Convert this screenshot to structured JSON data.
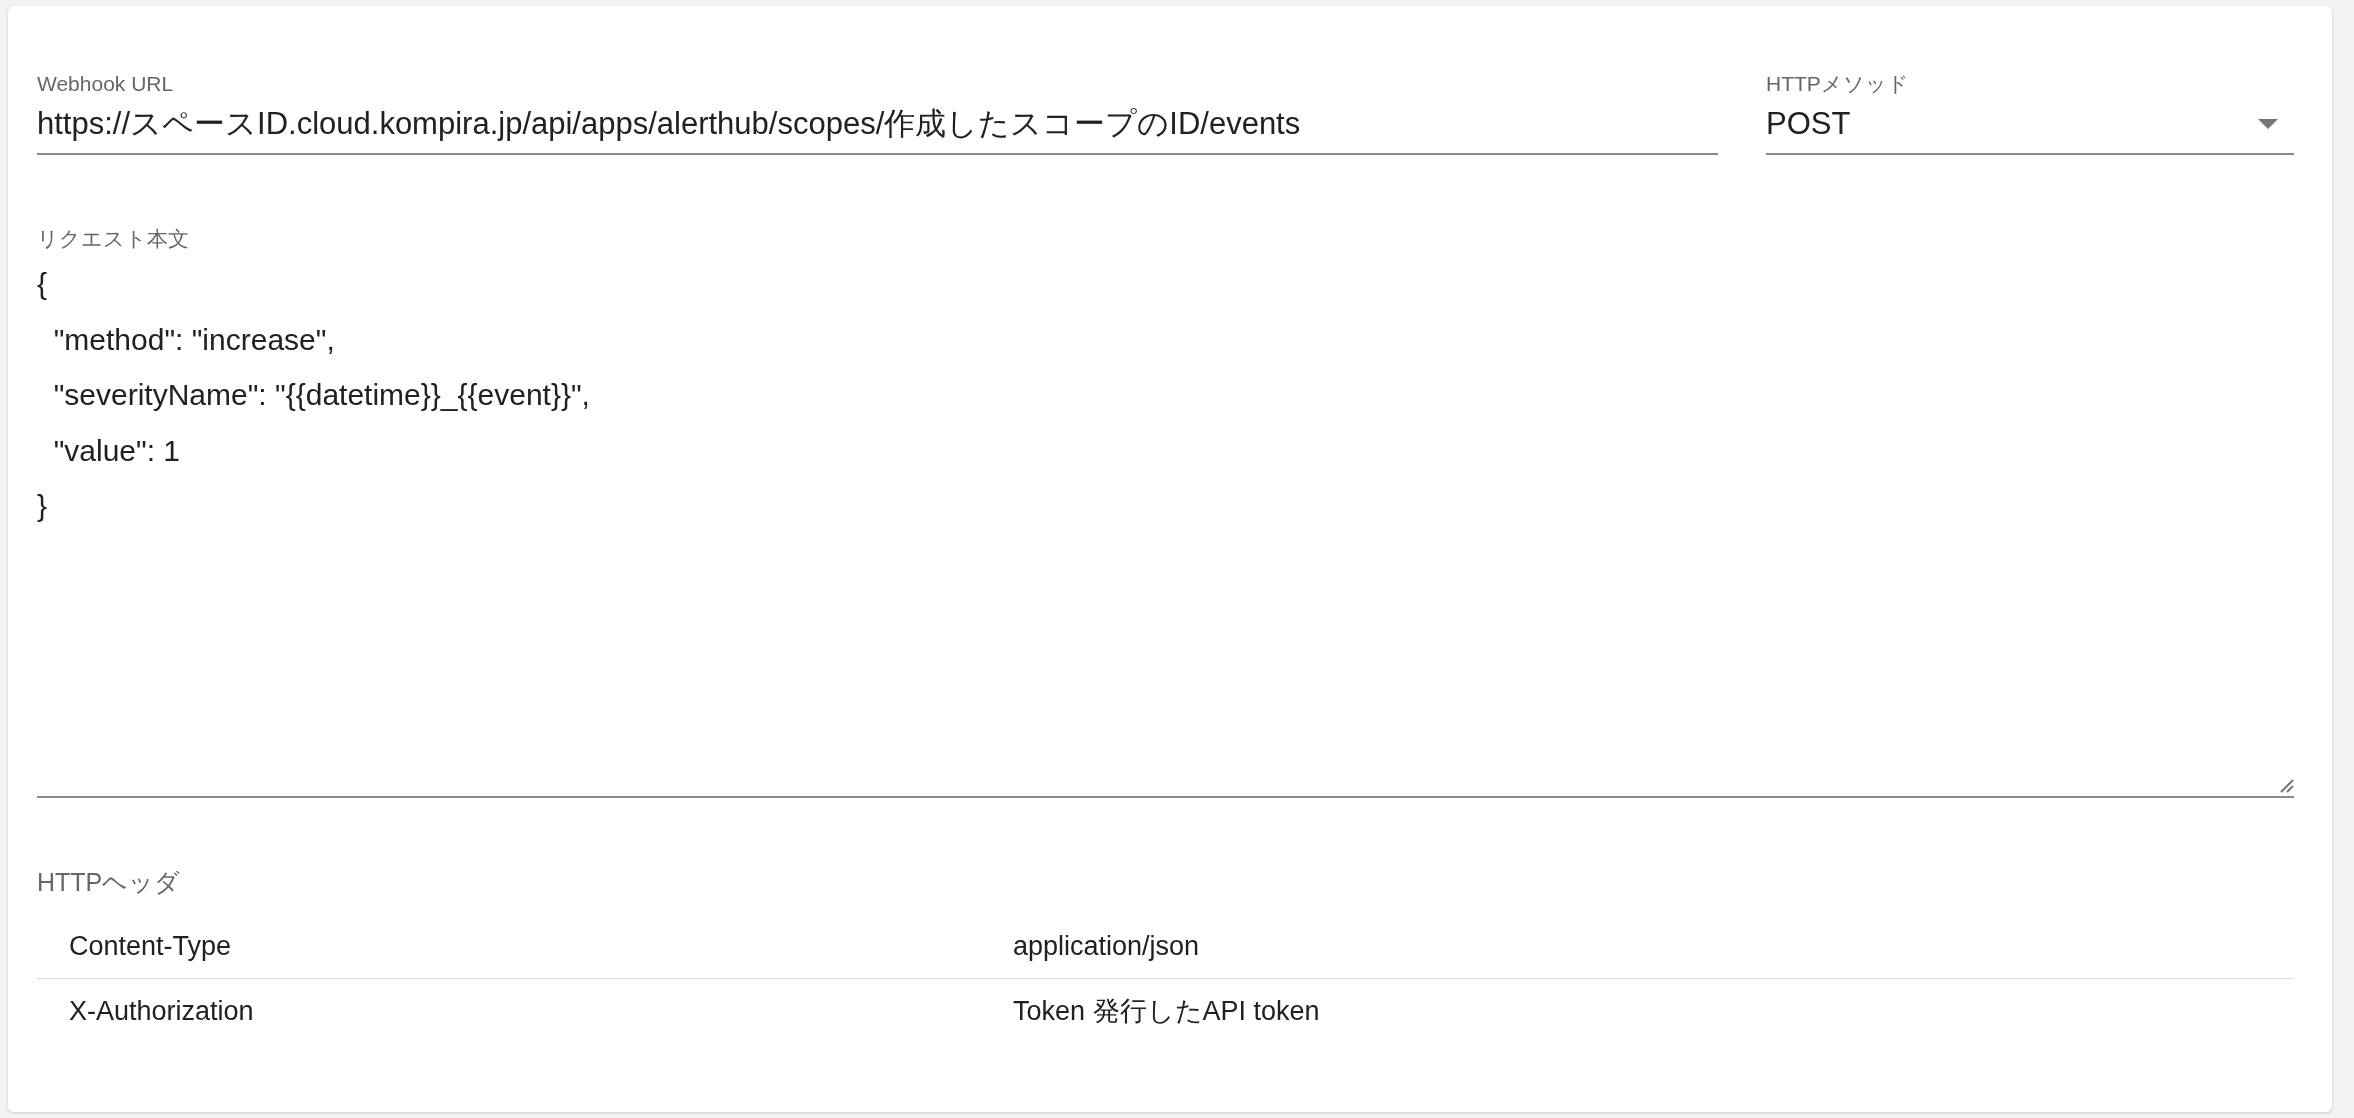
{
  "webhook_url": {
    "label": "Webhook URL",
    "value": "https://スペースID.cloud.kompira.jp/api/apps/alerthub/scopes/作成したスコープのID/events"
  },
  "http_method": {
    "label": "HTTPメソッド",
    "value": "POST"
  },
  "request_body": {
    "label": "リクエスト本文",
    "lines": [
      "{",
      "  \"method\": \"increase\",",
      "  \"severityName\": \"{{datetime}}_{{event}}\",",
      "  \"value\": 1",
      "}"
    ]
  },
  "http_headers": {
    "label": "HTTPヘッダ",
    "rows": [
      {
        "name": "Content-Type",
        "value": "application/json"
      },
      {
        "name": "X-Authorization",
        "value": "Token 発行したAPI token"
      }
    ]
  }
}
